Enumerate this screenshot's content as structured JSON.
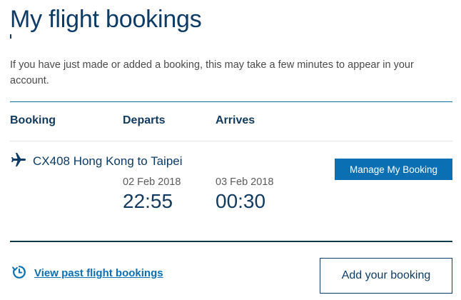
{
  "header": {
    "title": "My flight bookings",
    "notice": "If you have just made or added a booking, this may take a few minutes to appear in your account."
  },
  "table": {
    "columns": [
      "Booking",
      "Departs",
      "Arrives"
    ]
  },
  "bookings": [
    {
      "icon": "plane-icon",
      "flight": "CX408 Hong Kong to Taipei",
      "depart_date": "02 Feb 2018",
      "depart_time": "22:55",
      "arrive_date": "03 Feb 2018",
      "arrive_time": "00:30",
      "action_label": "Manage My Booking"
    }
  ],
  "footer": {
    "past_icon": "history-icon",
    "past_link": "View past flight bookings",
    "add_label": "Add your booking"
  },
  "colors": {
    "brand_dark": "#0d3b66",
    "brand_blue": "#0b6fb3",
    "divider": "#12374f"
  }
}
